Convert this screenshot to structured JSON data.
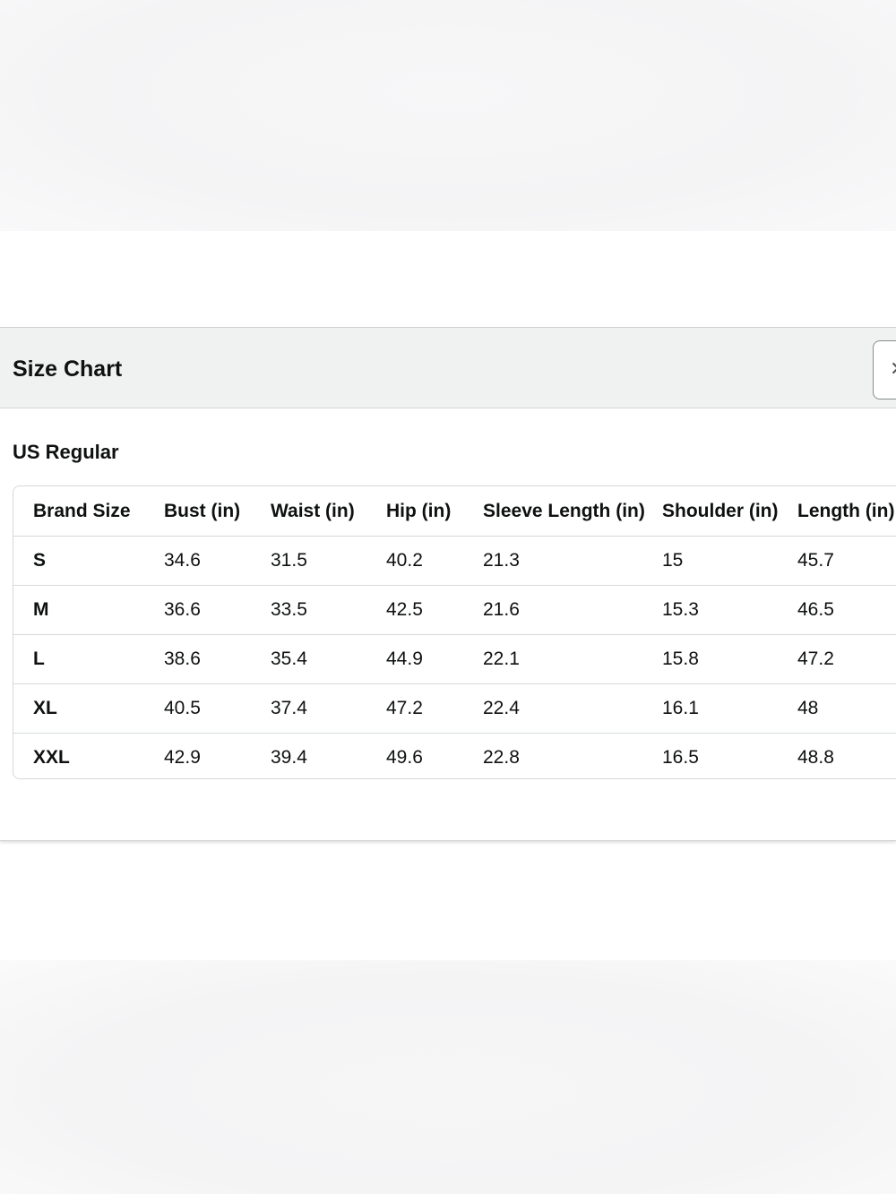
{
  "popover": {
    "title": "Size Chart",
    "close_icon": "close-icon",
    "section_title": "US Regular"
  },
  "size_table": {
    "headers": [
      "Brand Size",
      "Bust (in)",
      "Waist (in)",
      "Hip (in)",
      "Sleeve Length (in)",
      "Shoulder (in)",
      "Length (in)"
    ],
    "rows": [
      [
        "S",
        "34.6",
        "31.5",
        "40.2",
        "21.3",
        "15",
        "45.7"
      ],
      [
        "M",
        "36.6",
        "33.5",
        "42.5",
        "21.6",
        "15.3",
        "46.5"
      ],
      [
        "L",
        "38.6",
        "35.4",
        "44.9",
        "22.1",
        "15.8",
        "47.2"
      ],
      [
        "XL",
        "40.5",
        "37.4",
        "47.2",
        "22.4",
        "16.1",
        "48"
      ],
      [
        "XXL",
        "42.9",
        "39.4",
        "49.6",
        "22.8",
        "16.5",
        "48.8"
      ]
    ]
  },
  "colors": {
    "header_background": "#f0f2f2",
    "border": "#d5d9d9",
    "text": "#0f1111"
  }
}
